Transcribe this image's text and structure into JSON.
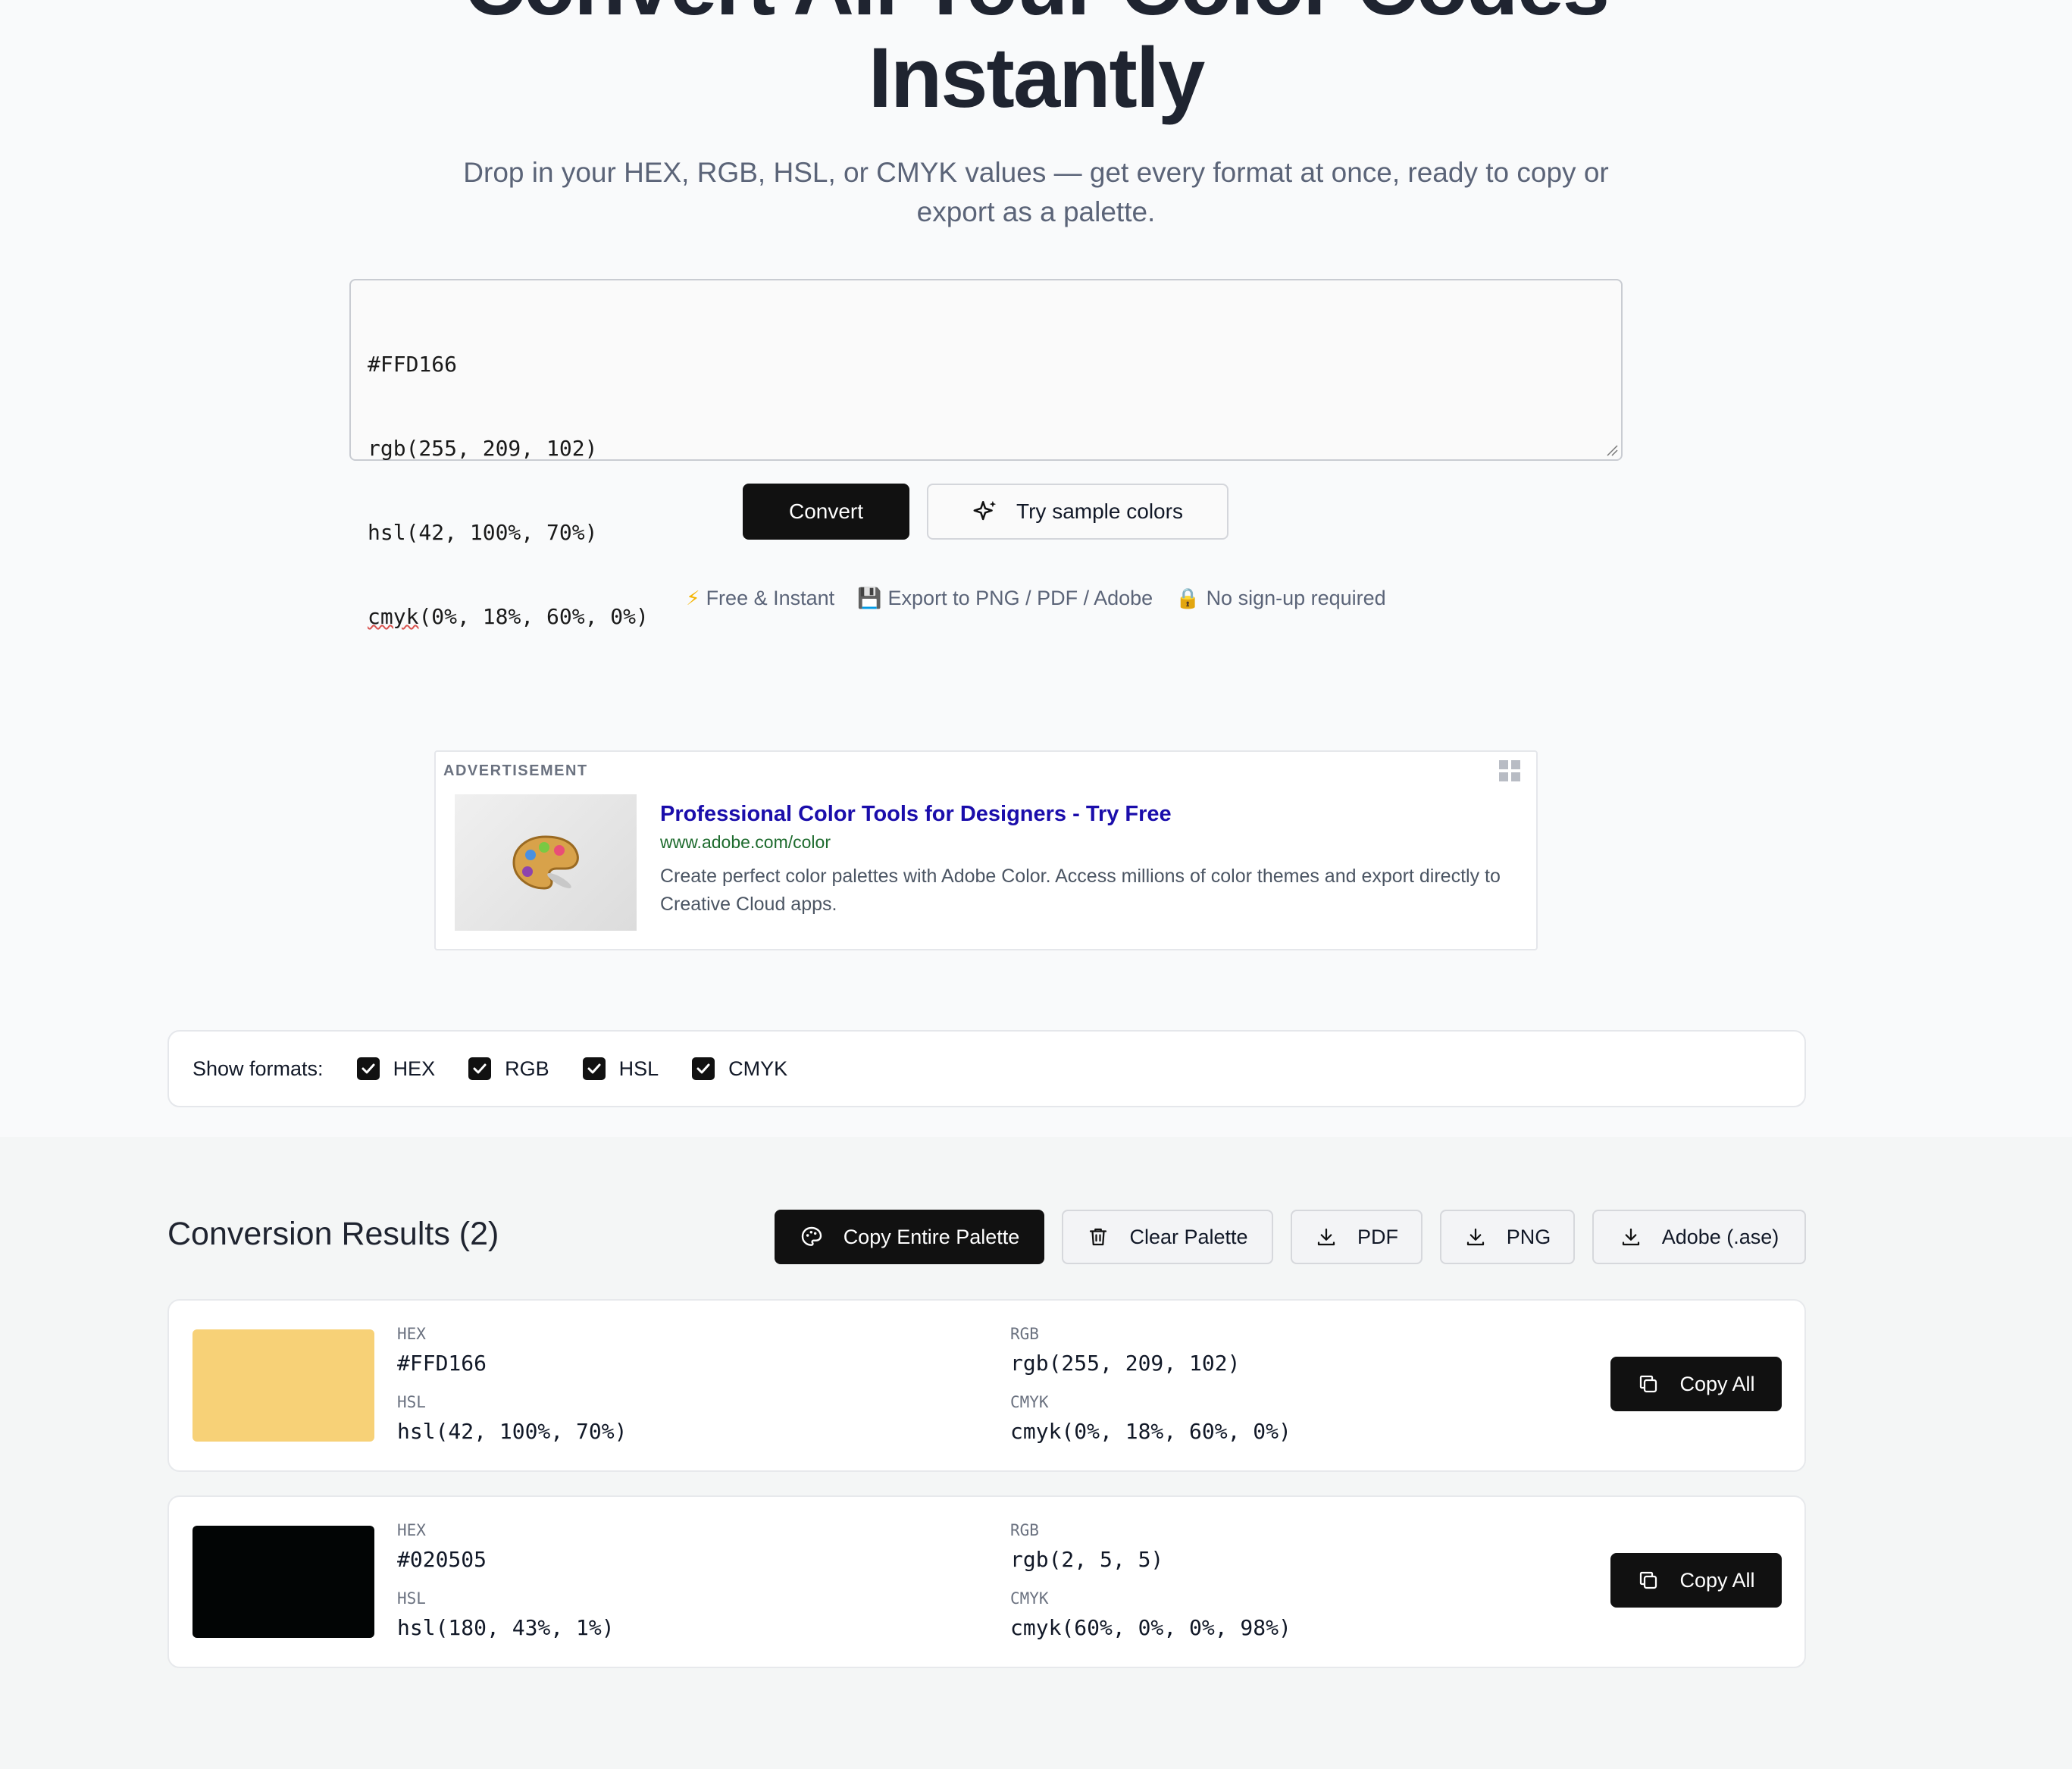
{
  "hero": {
    "title_line1": "Convert All Your Color Codes",
    "title_line2": "Instantly",
    "subtitle": "Drop in your HEX, RGB, HSL, or CMYK values — get every format at once, ready to copy or export as a palette."
  },
  "input": {
    "lines": [
      "#FFD166",
      "rgb(255, 209, 102)",
      "hsl(42, 100%, 70%)",
      "cmyk(0%, 18%, 60%, 0%)"
    ],
    "squiggle_word": "cmyk",
    "last_line_rest": "(0%, 18%, 60%, 0%)"
  },
  "actions": {
    "convert_label": "Convert",
    "sample_label": "Try sample colors"
  },
  "features": [
    {
      "icon": "lightning-icon",
      "glyph": "⚡",
      "label": "Free & Instant"
    },
    {
      "icon": "floppy-disk-icon",
      "glyph": "💾",
      "label": "Export to PNG / PDF / Adobe"
    },
    {
      "icon": "lock-icon",
      "glyph": "🔒",
      "label": "No sign-up required"
    }
  ],
  "ad": {
    "label": "ADVERTISEMENT",
    "title": "Professional Color Tools for Designers - Try Free",
    "url": "www.adobe.com/color",
    "description": "Create perfect color palettes with Adobe Color. Access millions of color themes and export directly to Creative Cloud apps.",
    "thumb_icon": "palette-icon"
  },
  "formats": {
    "label": "Show formats:",
    "options": [
      {
        "label": "HEX",
        "checked": true
      },
      {
        "label": "RGB",
        "checked": true
      },
      {
        "label": "HSL",
        "checked": true
      },
      {
        "label": "CMYK",
        "checked": true
      }
    ]
  },
  "results": {
    "title": "Conversion Results (2)",
    "toolbar": {
      "copy_palette": "Copy Entire Palette",
      "clear_palette": "Clear Palette",
      "pdf": "PDF",
      "png": "PNG",
      "ase": "Adobe (.ase)"
    },
    "labels": {
      "hex": "HEX",
      "rgb": "RGB",
      "hsl": "HSL",
      "cmyk": "CMYK"
    },
    "copy_all_label": "Copy All",
    "items": [
      {
        "swatch": "#F7D177",
        "hex": "#FFD166",
        "rgb": "rgb(255, 209, 102)",
        "hsl": "hsl(42, 100%, 70%)",
        "cmyk": "cmyk(0%, 18%, 60%, 0%)"
      },
      {
        "swatch": "#020505",
        "hex": "#020505",
        "rgb": "rgb(2, 5, 5)",
        "hsl": "hsl(180, 43%, 1%)",
        "cmyk": "cmyk(60%, 0%, 0%, 98%)"
      }
    ]
  },
  "colors": {
    "accent_dark": "#111111",
    "ad_title": "#1a0dab",
    "ad_url": "#1e6b2e"
  }
}
